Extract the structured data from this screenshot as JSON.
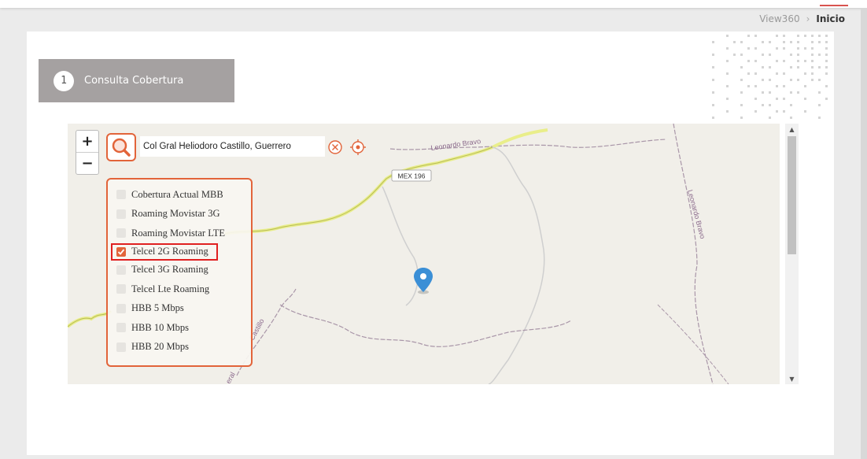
{
  "breadcrumb": {
    "root": "View360",
    "separator": "›",
    "current": "Inicio"
  },
  "step": {
    "number": "1",
    "label": "Consulta Cobertura"
  },
  "map": {
    "search_value": "Col Gral Heliodoro Castillo, Guerrero",
    "zoom_in": "+",
    "zoom_out": "−",
    "road_labels": {
      "leonardo_bravo_top": "Leonardo Bravo",
      "mex196": "MEX 196",
      "leonardo_bravo_right": "Leonardo Bravo",
      "castillo": "Castillo",
      "eral": "eral"
    },
    "layers": [
      {
        "label": "Cobertura Actual MBB",
        "checked": false
      },
      {
        "label": "Roaming Movistar 3G",
        "checked": false
      },
      {
        "label": "Roaming Movistar LTE",
        "checked": false
      },
      {
        "label": "Telcel 2G Roaming",
        "checked": true
      },
      {
        "label": "Telcel 3G Roaming",
        "checked": false
      },
      {
        "label": "Telcel Lte Roaming",
        "checked": false
      },
      {
        "label": "HBB 5 Mbps",
        "checked": false
      },
      {
        "label": "HBB 10 Mbps",
        "checked": false
      },
      {
        "label": "HBB 20 Mbps",
        "checked": false
      }
    ]
  },
  "colors": {
    "accent": "#e2643a",
    "highlight": "#e02020",
    "marker": "#3b8fd6",
    "step_bg": "#a5a1a1"
  }
}
